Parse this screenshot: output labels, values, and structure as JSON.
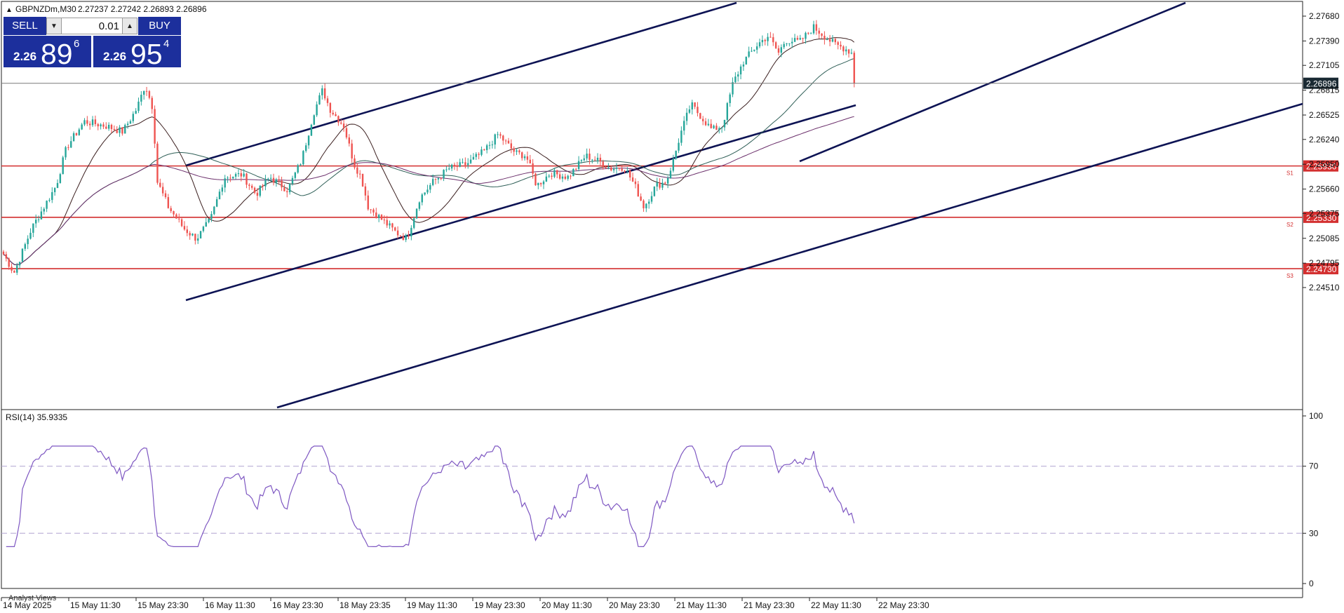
{
  "header": {
    "symbol_info": "GBPNZDm,M30",
    "ohlc": "2.27237 2.27242 2.26893 2.26896"
  },
  "trade_panel": {
    "sell_label": "SELL",
    "buy_label": "BUY",
    "lot_value": "0.01",
    "sell_price": {
      "small": "2.26",
      "big": "89",
      "sup": "6"
    },
    "buy_price": {
      "small": "2.26",
      "big": "95",
      "sup": "4"
    }
  },
  "price_axis": {
    "ticks": [
      2.2768,
      2.2739,
      2.27105,
      2.26815,
      2.26525,
      2.2624,
      2.2595,
      2.2566,
      2.25375,
      2.25085,
      2.24795,
      2.2451
    ],
    "labels": [
      "2.27680",
      "2.27390",
      "2.27105",
      "2.26815",
      "2.26525",
      "2.26240",
      "2.25950",
      "2.25660",
      "2.25375",
      "2.25085",
      "2.24795",
      "2.24510"
    ],
    "current_price": 2.26896,
    "current_price_label": "2.26896"
  },
  "levels": [
    {
      "price": 2.2593,
      "label": "2.25930",
      "tag": "S1"
    },
    {
      "price": 2.2533,
      "label": "2.25330",
      "tag": "S2"
    },
    {
      "price": 2.2473,
      "label": "2.24730",
      "tag": "S3"
    }
  ],
  "rsi": {
    "title": "RSI(14) 35.9335",
    "axis_labels": [
      "100",
      "70",
      "30",
      "0"
    ],
    "levels": [
      70,
      30
    ]
  },
  "time_axis": {
    "labels": [
      "14 May 2025",
      "15 May 11:30",
      "15 May 23:30",
      "16 May 11:30",
      "16 May 23:30",
      "18 May 23:35",
      "19 May 11:30",
      "19 May 23:30",
      "20 May 11:30",
      "20 May 23:30",
      "21 May 11:30",
      "21 May 23:30",
      "22 May 11:30",
      "22 May 23:30"
    ]
  },
  "footer": {
    "label": "Analyst Views"
  },
  "colors": {
    "bull": "#26a69a",
    "bear": "#ef5350",
    "level": "#d32f2f",
    "channel": "#0d1354",
    "rsi": "#7e57c2",
    "panel_blue": "#1c2f9c"
  },
  "chart_data": {
    "type": "candlestick",
    "timeframe": "M30",
    "y_range": [
      2.2438,
      2.2782
    ],
    "rsi_range": [
      0,
      100
    ],
    "key_prices": {
      "high_15may": 2.2691,
      "channel_breakout_high": 2.2765,
      "last_close": 2.26896
    }
  }
}
